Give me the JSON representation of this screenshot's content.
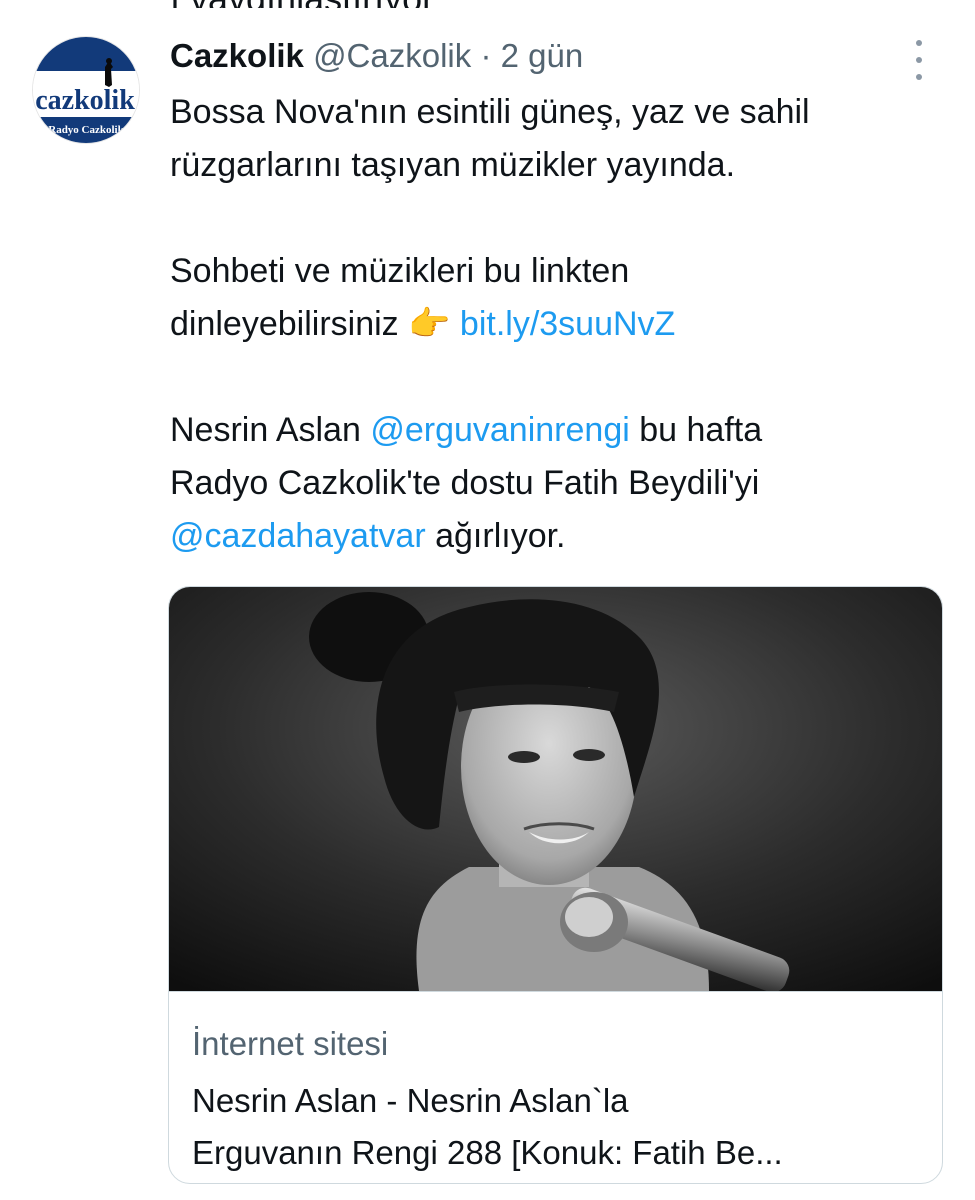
{
  "tweet": {
    "author": {
      "display_name": "Cazkolik",
      "handle": "@Cazkolik",
      "separator": "·",
      "time": "2 gün",
      "avatar_logo_text": "cazkolik",
      "avatar_logo_subtext": "Radyo Cazkolik"
    },
    "more_icon": "more-options-icon",
    "lines": {
      "l1": "Bossa Nova'nın esintili güneş, yaz ve sahil",
      "l2": "rüzgarlarını taşıyan müzikler yayında.",
      "l3": "Sohbeti ve müzikleri bu linkten",
      "l4_text": "dinleyebilirsiniz",
      "l4_emoji": "👉",
      "l4_link": "bit.ly/3suuNvZ",
      "l5_a": "Nesrin Aslan",
      "l5_mention": "@erguvaninrengi",
      "l5_b": "bu hafta",
      "l6": "Radyo Cazkolik'te dostu Fatih Beydili'yi",
      "l7_mention": "@cazdahayatvar",
      "l7_b": "ağırlıyor."
    },
    "card": {
      "image": "black-and-white photo of a woman with a bob haircut singing at a microphone",
      "domain": "İnternet sitesi",
      "title_line1": "Nesrin Aslan - Nesrin Aslan`la",
      "title_line2": "Erguvanın Rengi 288 [Konuk: Fatih Be..."
    }
  },
  "colors": {
    "link": "#1d9bf0",
    "secondary_text": "#536471",
    "primary_text": "#0f1419",
    "border": "#cfd9de",
    "avatar_blue": "#123a7a"
  }
}
